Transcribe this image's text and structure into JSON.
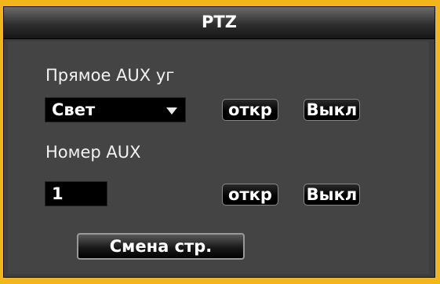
{
  "window": {
    "title": "PTZ"
  },
  "aux_direct": {
    "label": "Прямое AUX уг",
    "select_value": "Свет",
    "open_label": "откр",
    "close_label": "Выкл"
  },
  "aux_number": {
    "label": "Номер AUX",
    "value": "1",
    "open_label": "откр",
    "close_label": "Выкл"
  },
  "footer": {
    "switch_page_label": "Смена стр."
  },
  "colors": {
    "frame": "#f2b61a",
    "panel": "#444444",
    "field": "#000000"
  }
}
